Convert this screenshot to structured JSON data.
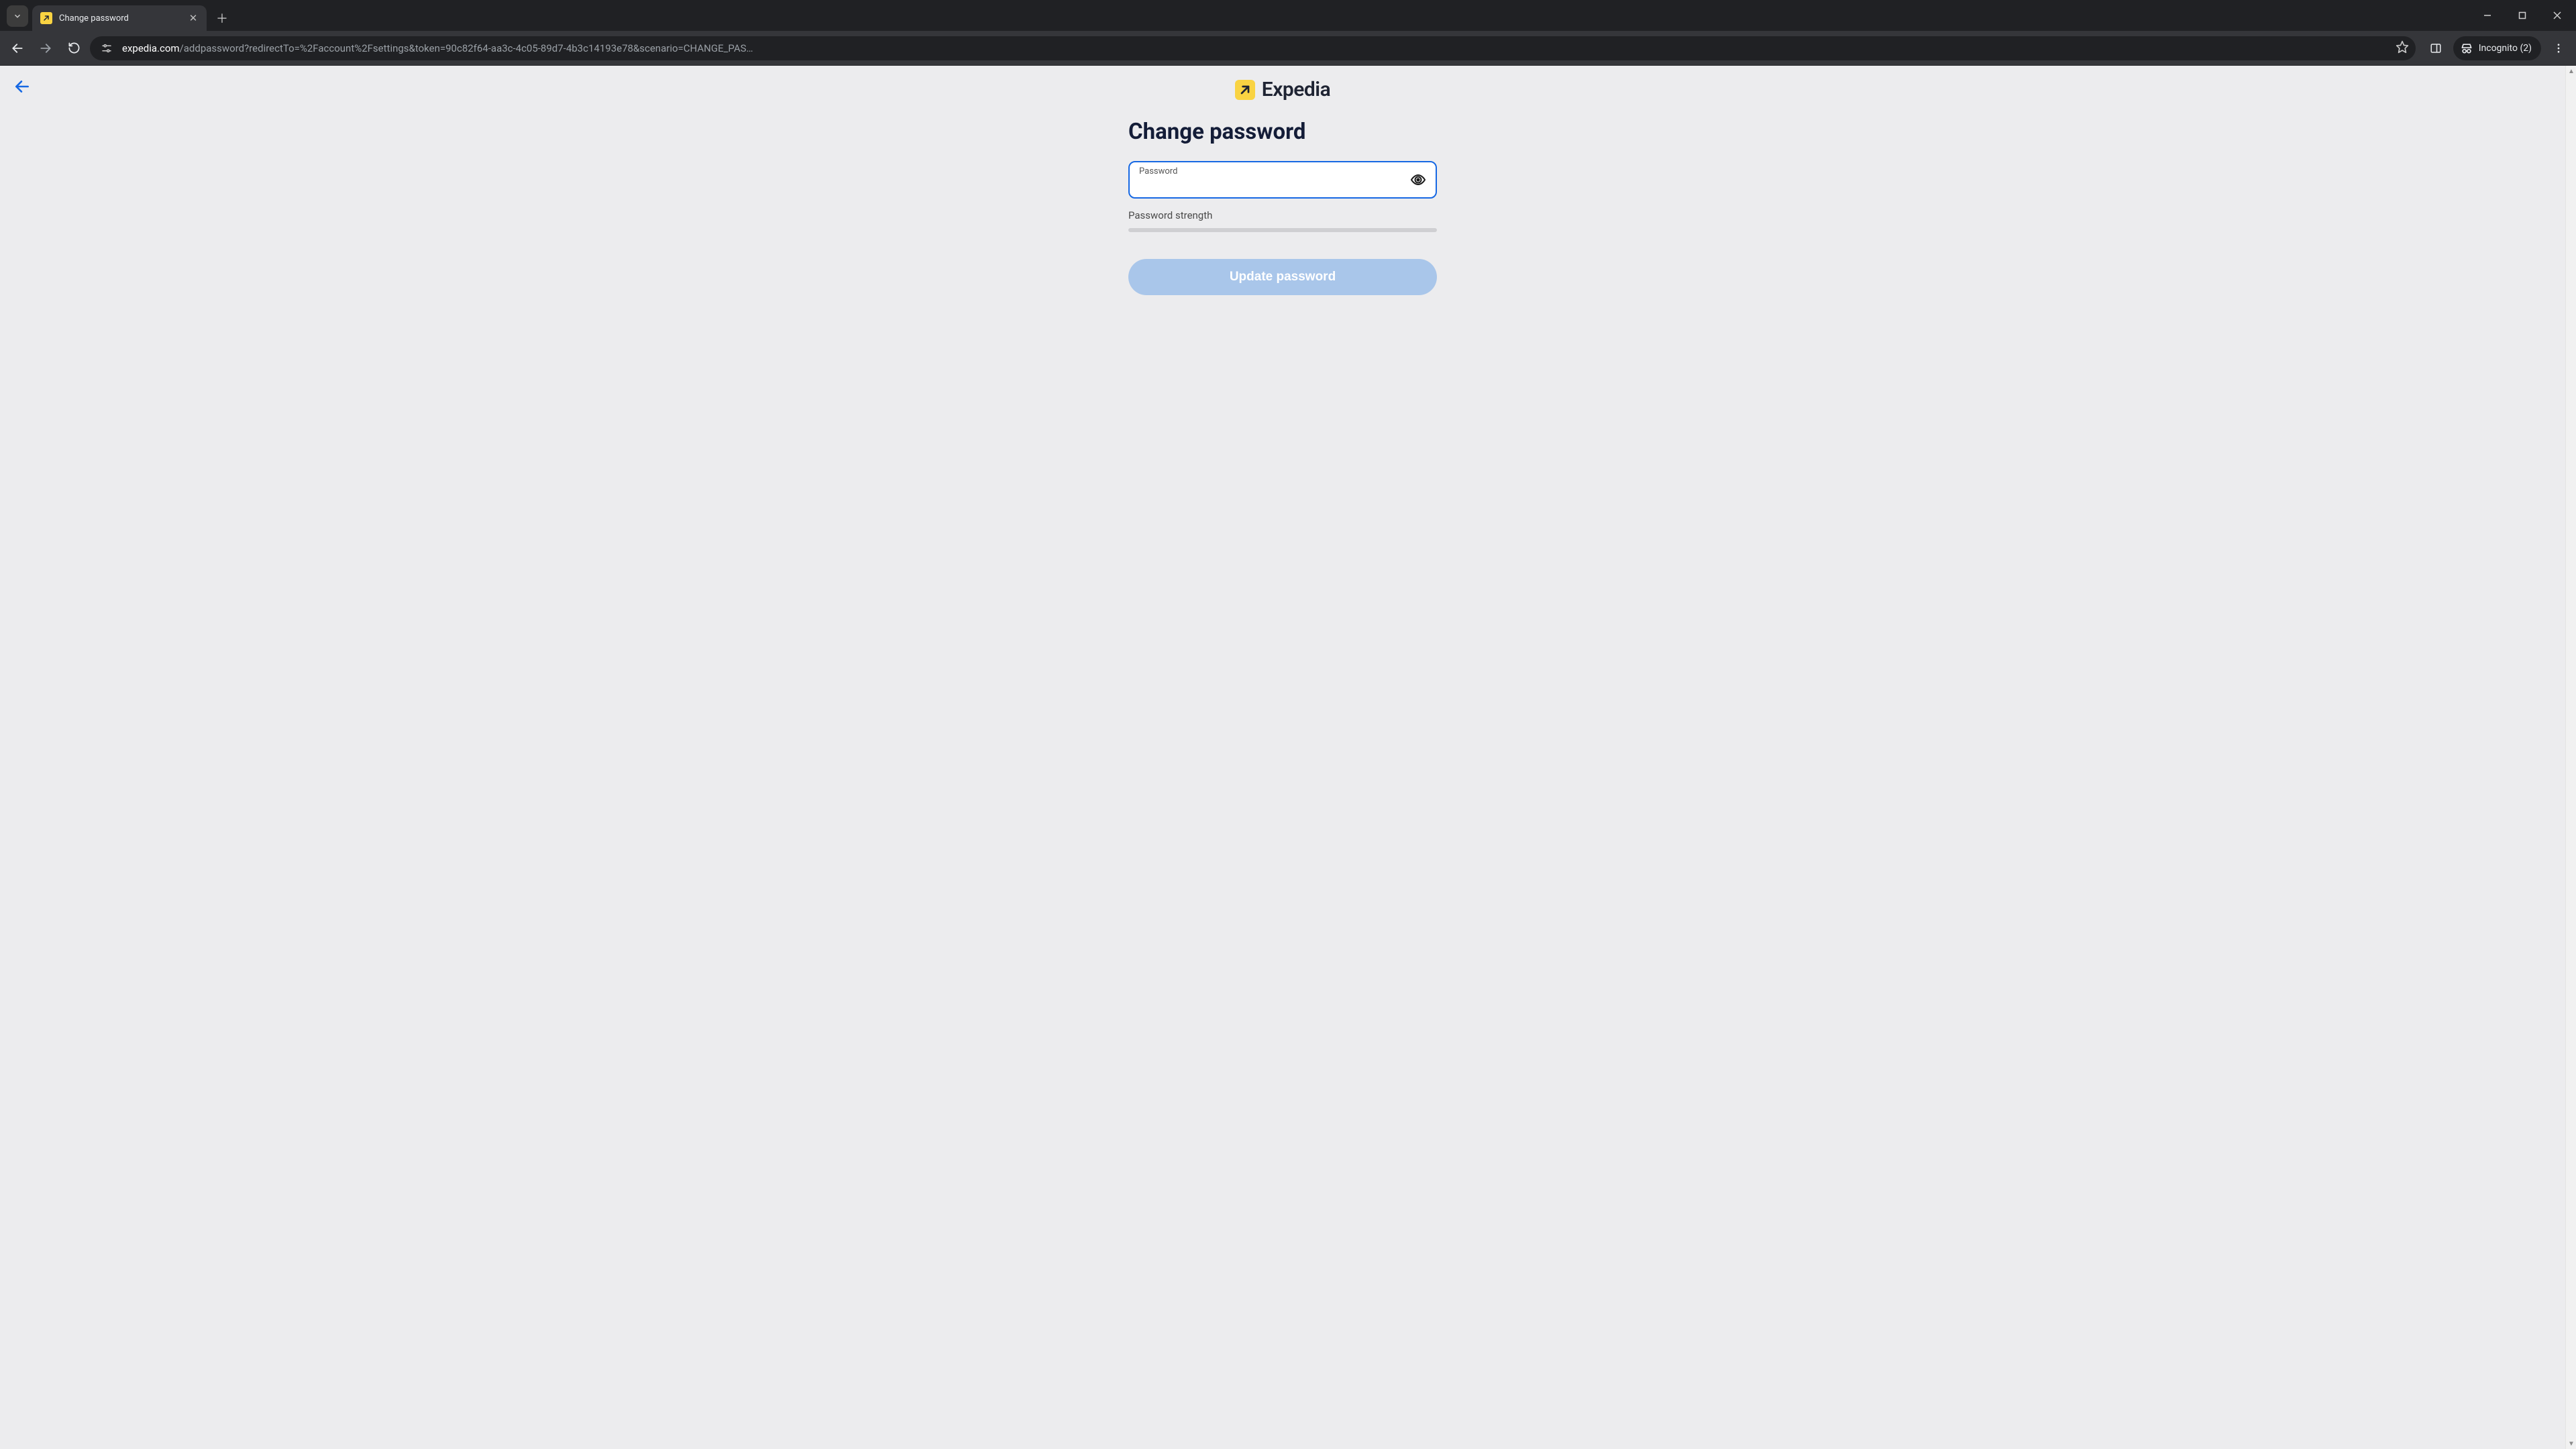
{
  "browser": {
    "tab_title": "Change password",
    "url_domain": "expedia.com",
    "url_path": "/addpassword?redirectTo=%2Faccount%2Fsettings&token=90c82f64-aa3c-4c05-89d7-4b3c14193e78&scenario=CHANGE_PAS…",
    "incognito_label": "Incognito (2)"
  },
  "page": {
    "brand_name": "Expedia",
    "heading": "Change password",
    "password_label": "Password",
    "password_value": "",
    "strength_label": "Password strength",
    "submit_label": "Update password"
  }
}
